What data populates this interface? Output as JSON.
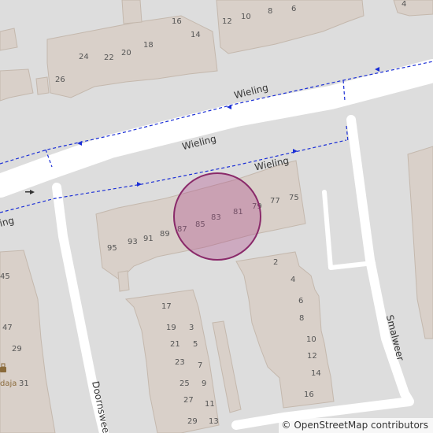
{
  "map": {
    "streets": {
      "wieling_main": "Wieling",
      "wieling_north": "Wieling",
      "wieling_south": "Wieling",
      "wieling_west_partial": "ling",
      "smalweer": "Smalweer",
      "doornsweer_partial": "Doornswee"
    },
    "poi": {
      "partial_label": "daja",
      "icon": "shop-icon"
    },
    "house_numbers": {
      "north_row_right": [
        "12",
        "10",
        "8",
        "6",
        "4"
      ],
      "north_row_left": [
        "26",
        "24",
        "22",
        "20",
        "18",
        "16",
        "14"
      ],
      "center_row": [
        "95",
        "93",
        "91",
        "89",
        "87",
        "85",
        "83",
        "81",
        "79",
        "77",
        "75"
      ],
      "east_column": [
        "2",
        "4",
        "6",
        "8",
        "10",
        "12",
        "14",
        "16"
      ],
      "south_block_left": [
        "17",
        "19",
        "21",
        "23",
        "25",
        "27",
        "29"
      ],
      "south_block_right": [
        "3",
        "5",
        "7",
        "9",
        "11",
        "13"
      ],
      "west_column": [
        "45",
        "47",
        "29",
        "31"
      ]
    },
    "highlight": {
      "color": "#b04a8a",
      "fill_opacity": 0.35
    },
    "colors": {
      "background": "#dddddd",
      "building": "#d9d0c9",
      "building_stroke": "#c4b8ad",
      "road": "#ffffff",
      "path": "#1a2ed6"
    }
  },
  "attribution": {
    "copyright": "©",
    "link_text": "OpenStreetMap",
    "suffix": "contributors"
  }
}
